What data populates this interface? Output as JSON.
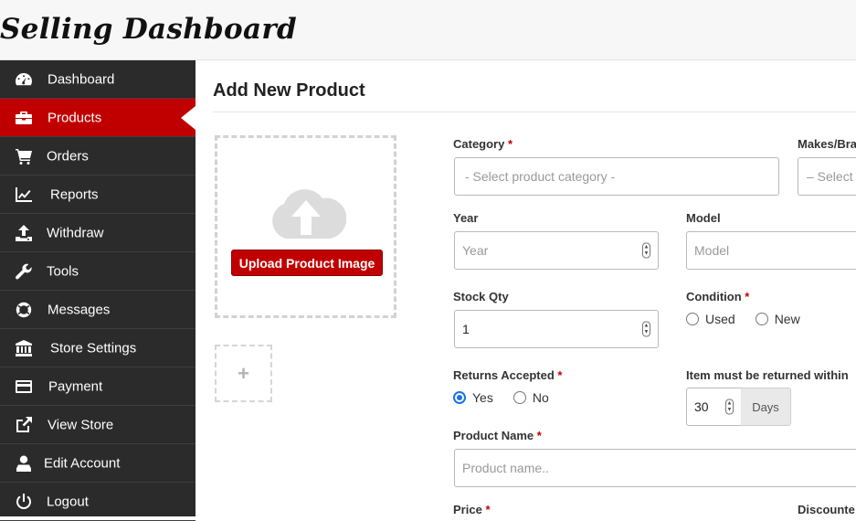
{
  "app": {
    "brand": "Selling Dashboard"
  },
  "sidebar": {
    "items": [
      {
        "label": "Dashboard",
        "icon": "tachometer-icon",
        "active": false
      },
      {
        "label": "Products",
        "icon": "briefcase-icon",
        "active": true
      },
      {
        "label": "Orders",
        "icon": "shopping-cart-icon",
        "active": false
      },
      {
        "label": "Reports",
        "icon": "line-chart-icon",
        "active": false
      },
      {
        "label": "Withdraw",
        "icon": "upload-icon",
        "active": false
      },
      {
        "label": "Tools",
        "icon": "wrench-icon",
        "active": false
      },
      {
        "label": "Messages",
        "icon": "life-ring-icon",
        "active": false
      },
      {
        "label": "Store Settings",
        "icon": "bank-icon",
        "active": false
      },
      {
        "label": "Payment",
        "icon": "credit-card-icon",
        "active": false
      },
      {
        "label": "View Store",
        "icon": "external-link-icon",
        "active": false
      },
      {
        "label": "Edit Account",
        "icon": "user-icon",
        "active": false
      },
      {
        "label": "Logout",
        "icon": "power-icon",
        "active": false
      }
    ]
  },
  "main": {
    "title": "Add New Product",
    "upload": {
      "button_label": "Upload Product Image",
      "add_label": "+"
    },
    "form": {
      "category": {
        "label": "Category",
        "required": "*",
        "placeholder": "- Select product category -"
      },
      "makes": {
        "label": "Makes/Bra",
        "placeholder": "– Select a"
      },
      "year": {
        "label": "Year",
        "placeholder": "Year"
      },
      "model": {
        "label": "Model",
        "placeholder": "Model"
      },
      "stock_qty": {
        "label": "Stock Qty",
        "value": "1"
      },
      "condition": {
        "label": "Condition",
        "required": "*",
        "options": [
          "Used",
          "New"
        ],
        "selected": null
      },
      "returns_accepted": {
        "label": "Returns Accepted",
        "required": "*",
        "options": [
          "Yes",
          "No"
        ],
        "selected": "Yes"
      },
      "return_within": {
        "label": "Item must be returned within",
        "value": "30",
        "addon": "Days"
      },
      "product_name": {
        "label": "Product Name",
        "required": "*",
        "placeholder": "Product name.."
      },
      "price": {
        "label": "Price",
        "required": "*"
      },
      "discounted": {
        "label": "Discounte"
      }
    }
  },
  "colors": {
    "accent": "#c00000",
    "sidebar_bg": "#2b2b2b",
    "radio_checked": "#1a73e8"
  }
}
